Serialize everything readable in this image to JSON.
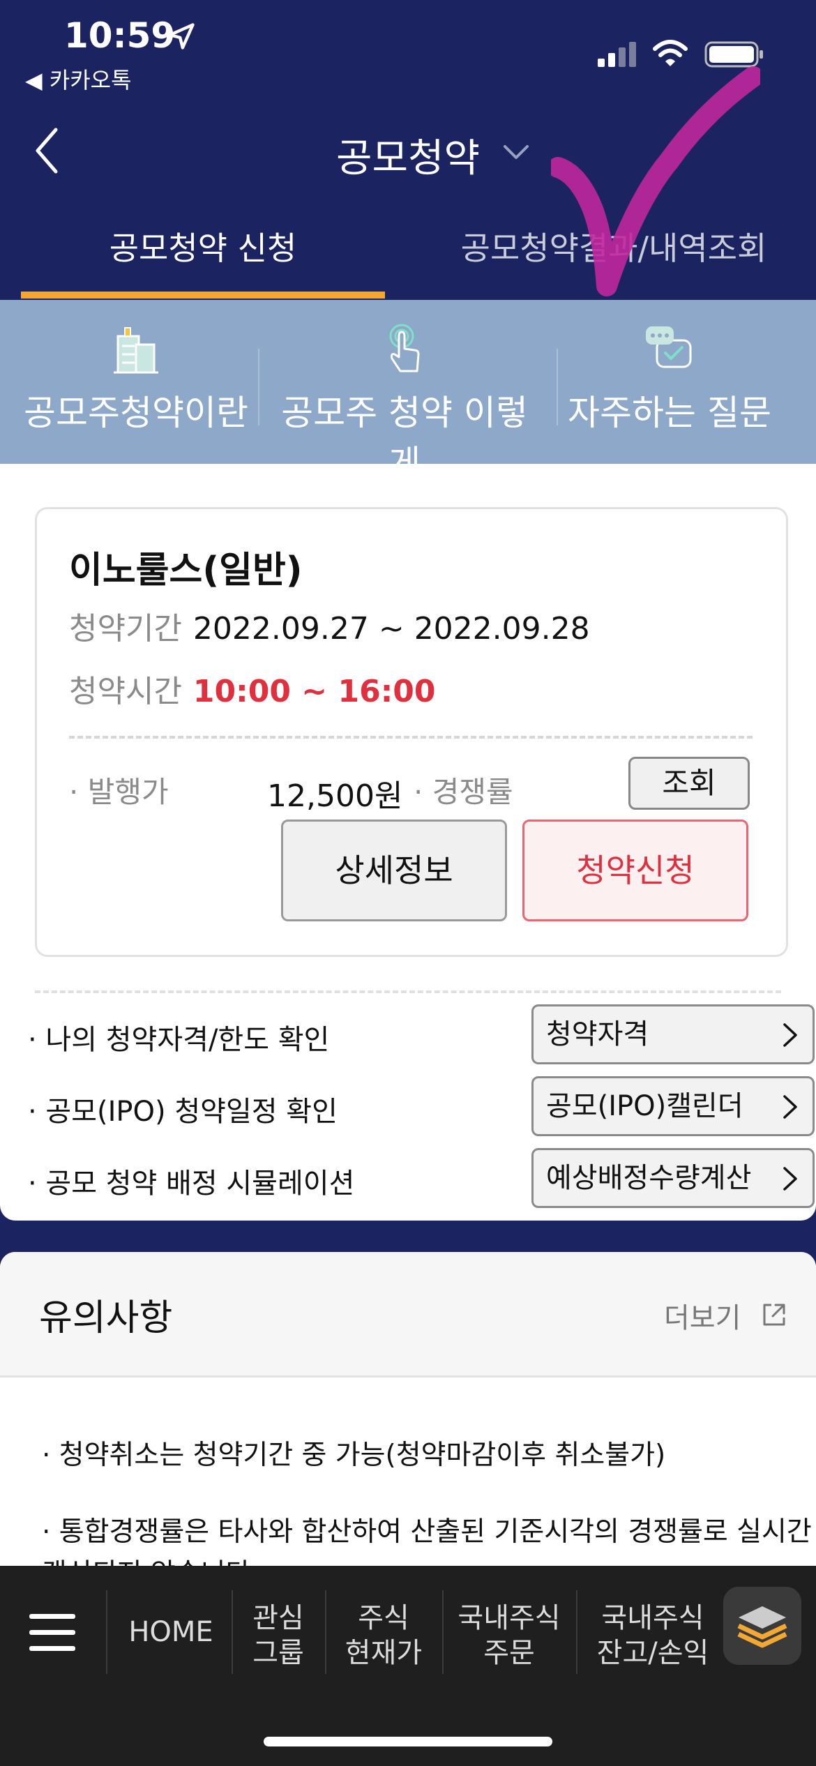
{
  "status": {
    "time": "10:59",
    "back_app": "◀ 카카오톡"
  },
  "header": {
    "title": "공모청약"
  },
  "tabs": [
    {
      "label": "공모청약 신청"
    },
    {
      "label": "공모청약결과/내역조회"
    }
  ],
  "quick_menu": [
    {
      "label": "공모주청약이란",
      "icon": "building-icon"
    },
    {
      "label": "공모주 청약 이렇게",
      "icon": "touch-icon"
    },
    {
      "label": "자주하는 질문",
      "icon": "chat-check-icon"
    }
  ],
  "card": {
    "name": "이노룰스(일반)",
    "period_label": "청약기간",
    "period_value": "2022.09.27 ~ 2022.09.28",
    "time_label": "청약시간",
    "time_value": "10:00 ~ 16:00",
    "issue_label": "· 발행가",
    "issue_value": "12,500원",
    "competition_label": "· 경쟁률",
    "query_button": "조회",
    "detail_button": "상세정보",
    "apply_button": "청약신청"
  },
  "links": [
    {
      "text": "· 나의 청약자격/한도 확인",
      "button": "청약자격"
    },
    {
      "text": "· 공모(IPO) 청약일정 확인",
      "button": "공모(IPO)캘린더"
    },
    {
      "text": "· 공모 청약 배정 시뮬레이션",
      "button": "예상배정수량계산"
    }
  ],
  "notice": {
    "title": "유의사항",
    "more": "더보기",
    "items": [
      "· 청약취소는 청약기간 중 가능(청약마감이후 취소불가)",
      "· 통합경쟁률은 타사와 합산하여 산출된 기준시각의 경쟁률로 실시간",
      "갱신되지 않습니다."
    ]
  },
  "bottom_nav": [
    {
      "label": "HOME"
    },
    {
      "label": "관심\n그룹"
    },
    {
      "label": "주식\n현재가"
    },
    {
      "label": "국내주식\n주문"
    },
    {
      "label": "국내주식\n잔고/손익"
    }
  ],
  "colors": {
    "navy": "#1b2460",
    "accent_orange": "#f2a833",
    "quick_bg": "#8da8c8",
    "red": "#e0303e",
    "check_magenta": "#c0279e"
  }
}
